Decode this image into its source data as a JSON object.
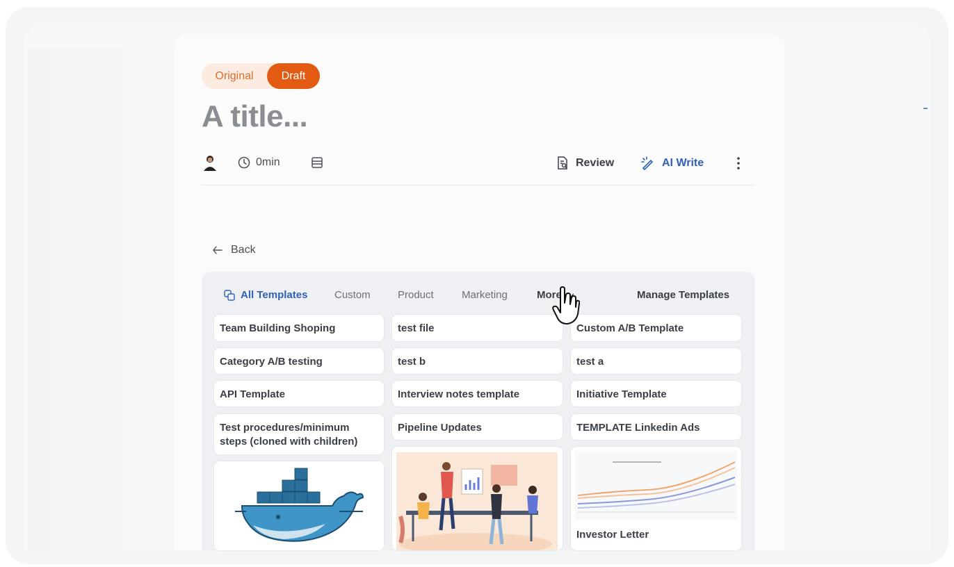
{
  "toggle": {
    "original": "Original",
    "draft": "Draft",
    "selected": "Draft"
  },
  "doc": {
    "title": "A title..."
  },
  "meta": {
    "read_time": "0min"
  },
  "actions": {
    "review": "Review",
    "ai_write": "AI Write"
  },
  "nav": {
    "back": "Back"
  },
  "templates": {
    "tabs": [
      {
        "label": "All Templates",
        "active": true
      },
      {
        "label": "Custom",
        "active": false
      },
      {
        "label": "Product",
        "active": false
      },
      {
        "label": "Marketing",
        "active": false
      },
      {
        "label": "More",
        "active": false
      }
    ],
    "manage": "Manage Templates",
    "rows": [
      [
        "Team Building Shoping",
        "test file",
        "Custom A/B Template"
      ],
      [
        "Category A/B testing",
        "test b",
        "test a"
      ],
      [
        "API Template",
        "Interview notes template",
        "Initiative Template"
      ],
      [
        "Test procedures/minimum steps (cloned with children)",
        "Pipeline Updates",
        "TEMPLATE Linkedin Ads"
      ]
    ],
    "image_cards": [
      {
        "image": "docker-whale-illustration",
        "label": ""
      },
      {
        "image": "team-meeting-illustration",
        "label": ""
      },
      {
        "image": "line-chart-thumbnail",
        "label": "Investor Letter"
      }
    ]
  },
  "colors": {
    "accent_orange": "#e35b12",
    "accent_blue": "#2f62b5"
  },
  "icons": [
    "avatar",
    "clock-icon",
    "document-icon",
    "review-icon",
    "ai-write-icon",
    "more-vertical-icon",
    "arrow-left-icon",
    "templates-icon",
    "chevron-down-icon",
    "hand-pointer-cursor"
  ]
}
